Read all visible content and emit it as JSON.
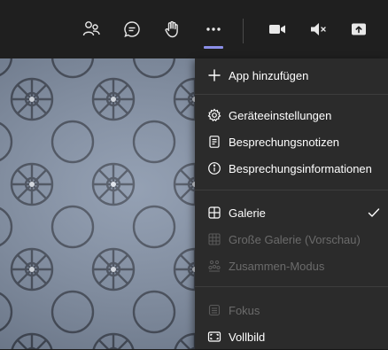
{
  "toolbar": {
    "buttons": [
      {
        "icon": "participants-icon"
      },
      {
        "icon": "chat-icon"
      },
      {
        "icon": "raise-hand-icon"
      },
      {
        "icon": "more-actions-icon"
      },
      {
        "icon": "camera-icon"
      },
      {
        "icon": "speaker-muted-icon"
      },
      {
        "icon": "share-screen-icon"
      }
    ],
    "active_accent": "#8b8fe8"
  },
  "menu": {
    "add_app": {
      "label": "App hinzufügen",
      "icon": "plus-icon"
    },
    "device_settings": {
      "label": "Geräteeinstellungen",
      "icon": "gear-icon"
    },
    "meeting_notes": {
      "label": "Besprechungsnotizen",
      "icon": "notes-icon"
    },
    "meeting_info": {
      "label": "Besprechungsinformationen",
      "icon": "info-icon"
    },
    "gallery": {
      "label": "Galerie",
      "icon": "grid-icon",
      "checked": true
    },
    "large_gallery": {
      "label": "Große Galerie (Vorschau)",
      "icon": "large-grid-icon",
      "disabled": true
    },
    "together_mode": {
      "label": "Zusammen-Modus",
      "icon": "together-mode-icon",
      "disabled": true
    },
    "focus": {
      "label": "Fokus",
      "icon": "focus-icon",
      "disabled": true
    },
    "fullscreen": {
      "label": "Vollbild",
      "icon": "fullscreen-icon"
    }
  },
  "colors": {
    "toolbar_bg": "#1f1f1f",
    "menu_bg": "#2b2b2b",
    "disabled_text": "#6b6b6b",
    "video_tint": "#7f8da3"
  }
}
